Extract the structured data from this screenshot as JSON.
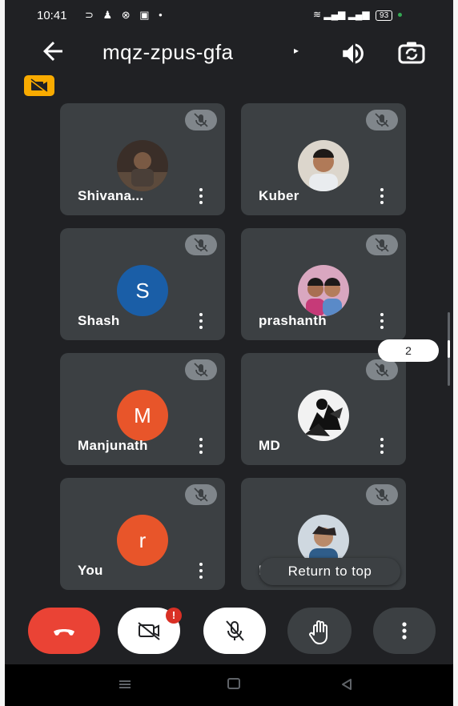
{
  "status_bar": {
    "time": "10:41",
    "battery": "93"
  },
  "meeting": {
    "code": "mqz-zpus-gfa",
    "caret": "▸"
  },
  "participants": [
    {
      "name": "Shivana...",
      "avatar_type": "photo",
      "muted": true
    },
    {
      "name": "Kuber",
      "avatar_type": "photo",
      "muted": true
    },
    {
      "name": "Shash",
      "avatar_type": "letter",
      "initial": "S",
      "avatar_color": "#1a5ea7",
      "muted": true
    },
    {
      "name": "prashanth",
      "avatar_type": "photo",
      "muted": true
    },
    {
      "name": "Manjunath",
      "avatar_type": "letter",
      "initial": "M",
      "avatar_color": "#e8552a",
      "muted": true
    },
    {
      "name": "MD",
      "avatar_type": "photo",
      "muted": true
    },
    {
      "name": "You",
      "avatar_type": "letter",
      "initial": "r",
      "avatar_color": "#e8552a",
      "muted": true
    },
    {
      "name": "Ba",
      "avatar_type": "photo",
      "muted": true
    }
  ],
  "page_indicator": "2",
  "return_to_top_label": "Return to top",
  "camera_alert": "!",
  "controls": {
    "end_call": "hangup-icon",
    "camera": "camera-off-icon",
    "microphone": "mic-off-icon",
    "raise_hand": "hand-icon",
    "more": "more-vert-icon"
  },
  "colors": {
    "background": "#202124",
    "tile": "#3c4043",
    "end_call": "#ea4335",
    "badge": "#f9ab00"
  }
}
